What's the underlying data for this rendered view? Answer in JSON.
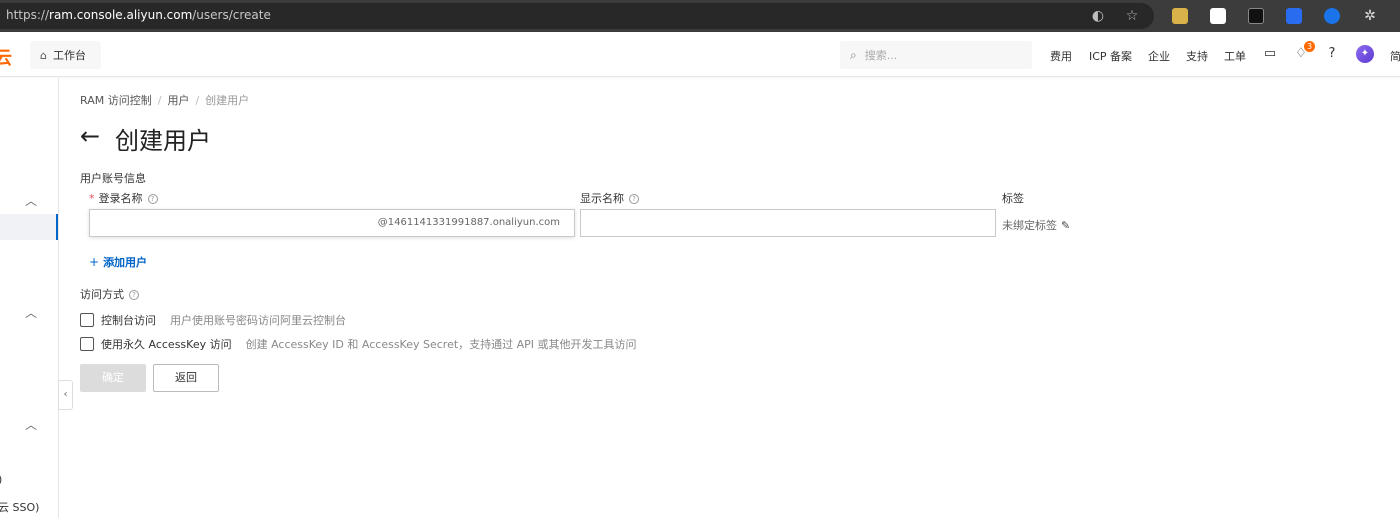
{
  "browser": {
    "url_prefix": "https://",
    "url_host": "ram.console.aliyun.com",
    "url_path": "/users/create"
  },
  "topnav": {
    "workbench": "工作台",
    "search_placeholder": "搜索...",
    "links": [
      "费用",
      "ICP 备案",
      "企业",
      "支持",
      "工单"
    ],
    "notification_count": "3",
    "lang_fragment": "简"
  },
  "sidebar": {
    "frag_1": ")",
    "frag_2": "云 SSO)"
  },
  "breadcrumb": {
    "items": [
      "RAM 访问控制",
      "用户",
      "创建用户"
    ]
  },
  "page": {
    "title": "创建用户",
    "section_title": "用户账号信息",
    "login_label": "登录名称",
    "login_suffix": "@1461141331991887.onaliyun.com",
    "display_label": "显示名称",
    "tag_label": "标签",
    "tag_value": "未绑定标签",
    "add_user": "添加用户",
    "access_label": "访问方式",
    "console_access": "控制台访问",
    "console_desc": "用户使用账号密码访问阿里云控制台",
    "ak_access": "使用永久 AccessKey 访问",
    "ak_desc": "创建 AccessKey ID 和 AccessKey Secret，支持通过 API 或其他开发工具访问",
    "ok_button": "确定",
    "back_button": "返回"
  },
  "colors": {
    "brand": "#ff6a00",
    "link": "#0064c8",
    "required": "#e34d59"
  }
}
